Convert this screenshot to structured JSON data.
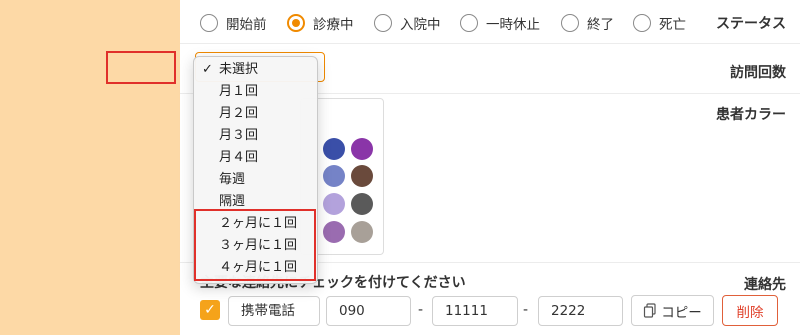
{
  "labels": {
    "status": "ステータス",
    "visit_count": "訪問回数",
    "patient_color": "患者カラー",
    "contact": "連絡先"
  },
  "status_options": [
    {
      "label": "開始前",
      "checked": false
    },
    {
      "label": "診療中",
      "checked": true
    },
    {
      "label": "入院中",
      "checked": false
    },
    {
      "label": "一時休止",
      "checked": false
    },
    {
      "label": "終了",
      "checked": false
    },
    {
      "label": "死亡",
      "checked": false
    }
  ],
  "visit_dropdown": {
    "selected": "未選択",
    "options": [
      "未選択",
      "月１回",
      "月２回",
      "月３回",
      "月４回",
      "毎週",
      "隔週",
      "２ヶ月に１回",
      "３ヶ月に１回",
      "４ヶ月に１回"
    ]
  },
  "colors": {
    "accent": "#f08a00",
    "label_bg": "#fdd9a6",
    "highlight": "#e0302a",
    "swatches": [
      "#3a4fa8",
      "#8a35a8",
      "#7583c7",
      "#6a4a3c",
      "#b3a2dc",
      "#5a5a5a",
      "#9a6cb0",
      "#a8a098"
    ]
  },
  "contact": {
    "instruction": "主要な連絡先にチェックを付けてください",
    "type": "携帯電話",
    "tel1": "090",
    "tel2": "11111",
    "tel3": "2222",
    "separator": "-",
    "copy_label": "コピー",
    "delete_label": "削除"
  }
}
